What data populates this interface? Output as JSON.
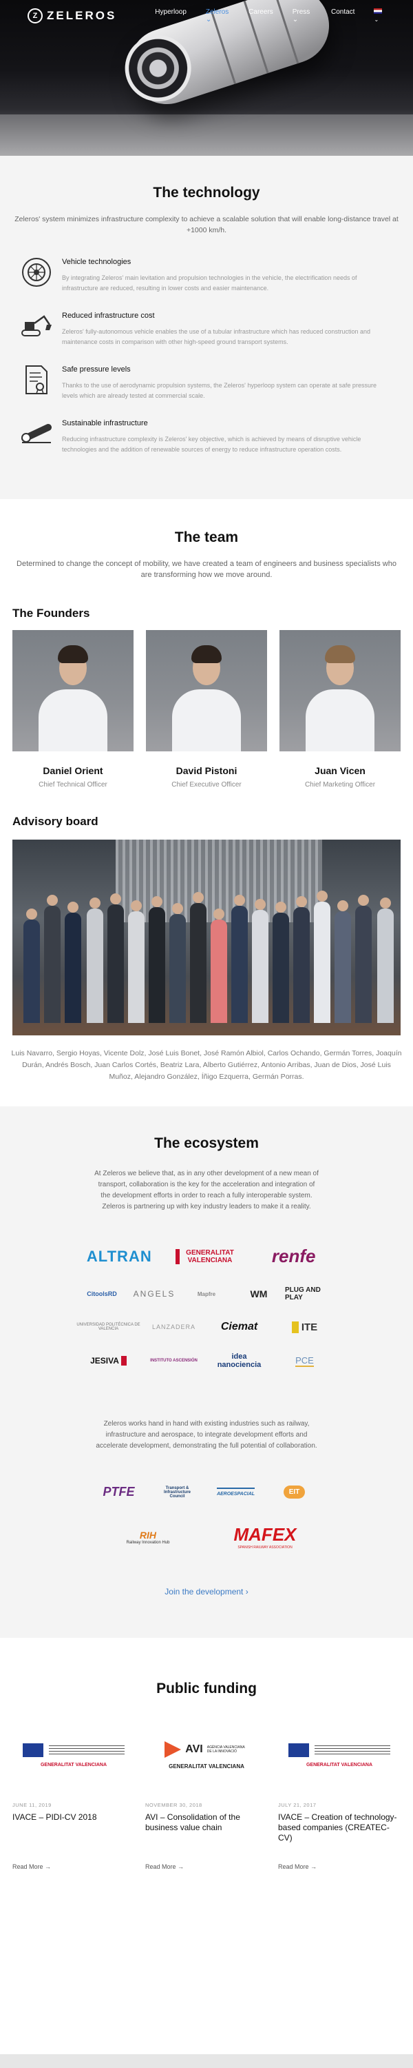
{
  "nav": {
    "logo_text": "ZELEROS",
    "items": [
      {
        "label": "Hyperloop"
      },
      {
        "label": "Zeleros",
        "caret": "⌄"
      },
      {
        "label": "Careers"
      },
      {
        "label": "Press",
        "caret": "⌄"
      },
      {
        "label": "Contact"
      }
    ]
  },
  "technology": {
    "title": "The technology",
    "lead": "Zeleros' system minimizes infrastructure complexity to achieve a scalable solution that will enable long-distance travel at +1000 km/h.",
    "features": [
      {
        "icon": "engine-icon",
        "title": "Vehicle technologies",
        "text": "By integrating Zeleros' main levitation and propulsion technologies in the vehicle, the electrification needs of infrastructure are reduced, resulting in lower costs and easier maintenance."
      },
      {
        "icon": "excavator-icon",
        "title": "Reduced infrastructure cost",
        "text": "Zeleros' fully-autonomous vehicle enables the use of a tubular infrastructure which has reduced construction and maintenance costs in comparison with other high-speed ground transport systems."
      },
      {
        "icon": "certificate-icon",
        "title": "Safe pressure levels",
        "text": "Thanks to the use of aerodynamic propulsion systems, the Zeleros' hyperloop system can operate at safe pressure levels which are already tested at commercial scale."
      },
      {
        "icon": "tube-icon",
        "title": "Sustainable infrastructure",
        "text": "Reducing infrastructure complexity is Zeleros' key objective, which is achieved by means of disruptive vehicle technologies and the addition of renewable sources of energy to reduce infrastructure operation costs."
      }
    ]
  },
  "team": {
    "title": "The team",
    "lead": "Determined to change the concept of mobility, we have created a team of engineers and business specialists who are transforming how we move around.",
    "founders_title": "The Founders",
    "founders": [
      {
        "name": "Daniel Orient",
        "role": "Chief Technical Officer"
      },
      {
        "name": "David Pistoni",
        "role": "Chief Executive Officer"
      },
      {
        "name": "Juan Vicen",
        "role": "Chief Marketing Officer"
      }
    ],
    "advisory_title": "Advisory board",
    "advisors": "Luis Navarro, Sergio Hoyas, Vicente Dolz, José Luis Bonet, José Ramón Albiol, Carlos Ochando, Germán Torres, Joaquín Durán, Andrés Bosch, Juan Carlos Cortés, Beatriz Lara, Alberto Gutiérrez, Antonio Arribas, Juan de Dios, José Luis Muñoz, Alejandro González, Íñigo Ezquerra, Germán Porras."
  },
  "ecosystem": {
    "title": "The ecosystem",
    "lead": "At Zeleros we believe that, as in any other development of a new mean of transport, collaboration is the key for the acceleration and integration of the development efforts in order to reach a fully interoperable system. Zeleros is partnering up with key industry leaders to make it a reality.",
    "logos": [
      "ALTRAN",
      "GENERALITAT VALENCIANA",
      "renfe",
      "CitoolsRD",
      "ANGELS",
      "Mapfre",
      "WM",
      "PLUG AND PLAY",
      "UNIVERSIDAD POLITÉCNICA DE VALENCIA",
      "LANZADERA",
      "Ciemat",
      "ITE",
      "JESIVA",
      "INSTITUTO ASCENSIÓN",
      "idea nanociencia",
      "PCE"
    ],
    "lead2": "Zeleros works hand in hand with existing industries such as railway, infrastructure and aerospace, to integrate development efforts and accelerate development, demonstrating the full potential of collaboration.",
    "partners": [
      "PTFE",
      "Transport & Infrastructure Council",
      "AEROESPACIAL",
      "EIT",
      "RIH",
      "MAFEX"
    ],
    "partner_captions": {
      "rih": "Railway Innovation Hub",
      "mafex": "SPANISH RAILWAY ASSOCIATION"
    },
    "join_label": "Join the development  ›"
  },
  "funding": {
    "title": "Public funding",
    "cards": [
      {
        "date": "JUNE 11, 2019",
        "title": "IVACE – PIDI-CV 2018",
        "read_more": "Read More  →"
      },
      {
        "date": "NOVEMBER 30, 2018",
        "title": "AVI – Consolidation of the business value chain",
        "read_more": "Read More  →"
      },
      {
        "date": "JULY 21, 2017",
        "title": "IVACE – Creation of technology-based companies (CREATEC-CV)",
        "read_more": "Read More  →"
      }
    ],
    "card_logos": {
      "gva": "GENERALITAT VALENCIANA",
      "avi": "AVI",
      "avi_sub": "AGÈNCIA VALENCIANA DE LA INNOVACIÓ"
    }
  },
  "colors": {
    "accent": "#3b7ac4",
    "nav_active": "#4a8fe0",
    "section_bg": "#f4f4f4"
  }
}
